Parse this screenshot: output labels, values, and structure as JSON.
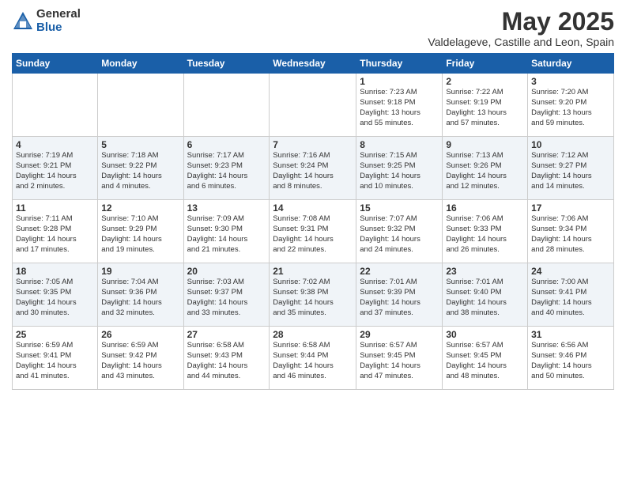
{
  "logo": {
    "general": "General",
    "blue": "Blue"
  },
  "header": {
    "month_year": "May 2025",
    "location": "Valdelageve, Castille and Leon, Spain"
  },
  "weekdays": [
    "Sunday",
    "Monday",
    "Tuesday",
    "Wednesday",
    "Thursday",
    "Friday",
    "Saturday"
  ],
  "rows": [
    [
      {
        "day": "",
        "info": ""
      },
      {
        "day": "",
        "info": ""
      },
      {
        "day": "",
        "info": ""
      },
      {
        "day": "",
        "info": ""
      },
      {
        "day": "1",
        "info": "Sunrise: 7:23 AM\nSunset: 9:18 PM\nDaylight: 13 hours\nand 55 minutes."
      },
      {
        "day": "2",
        "info": "Sunrise: 7:22 AM\nSunset: 9:19 PM\nDaylight: 13 hours\nand 57 minutes."
      },
      {
        "day": "3",
        "info": "Sunrise: 7:20 AM\nSunset: 9:20 PM\nDaylight: 13 hours\nand 59 minutes."
      }
    ],
    [
      {
        "day": "4",
        "info": "Sunrise: 7:19 AM\nSunset: 9:21 PM\nDaylight: 14 hours\nand 2 minutes."
      },
      {
        "day": "5",
        "info": "Sunrise: 7:18 AM\nSunset: 9:22 PM\nDaylight: 14 hours\nand 4 minutes."
      },
      {
        "day": "6",
        "info": "Sunrise: 7:17 AM\nSunset: 9:23 PM\nDaylight: 14 hours\nand 6 minutes."
      },
      {
        "day": "7",
        "info": "Sunrise: 7:16 AM\nSunset: 9:24 PM\nDaylight: 14 hours\nand 8 minutes."
      },
      {
        "day": "8",
        "info": "Sunrise: 7:15 AM\nSunset: 9:25 PM\nDaylight: 14 hours\nand 10 minutes."
      },
      {
        "day": "9",
        "info": "Sunrise: 7:13 AM\nSunset: 9:26 PM\nDaylight: 14 hours\nand 12 minutes."
      },
      {
        "day": "10",
        "info": "Sunrise: 7:12 AM\nSunset: 9:27 PM\nDaylight: 14 hours\nand 14 minutes."
      }
    ],
    [
      {
        "day": "11",
        "info": "Sunrise: 7:11 AM\nSunset: 9:28 PM\nDaylight: 14 hours\nand 17 minutes."
      },
      {
        "day": "12",
        "info": "Sunrise: 7:10 AM\nSunset: 9:29 PM\nDaylight: 14 hours\nand 19 minutes."
      },
      {
        "day": "13",
        "info": "Sunrise: 7:09 AM\nSunset: 9:30 PM\nDaylight: 14 hours\nand 21 minutes."
      },
      {
        "day": "14",
        "info": "Sunrise: 7:08 AM\nSunset: 9:31 PM\nDaylight: 14 hours\nand 22 minutes."
      },
      {
        "day": "15",
        "info": "Sunrise: 7:07 AM\nSunset: 9:32 PM\nDaylight: 14 hours\nand 24 minutes."
      },
      {
        "day": "16",
        "info": "Sunrise: 7:06 AM\nSunset: 9:33 PM\nDaylight: 14 hours\nand 26 minutes."
      },
      {
        "day": "17",
        "info": "Sunrise: 7:06 AM\nSunset: 9:34 PM\nDaylight: 14 hours\nand 28 minutes."
      }
    ],
    [
      {
        "day": "18",
        "info": "Sunrise: 7:05 AM\nSunset: 9:35 PM\nDaylight: 14 hours\nand 30 minutes."
      },
      {
        "day": "19",
        "info": "Sunrise: 7:04 AM\nSunset: 9:36 PM\nDaylight: 14 hours\nand 32 minutes."
      },
      {
        "day": "20",
        "info": "Sunrise: 7:03 AM\nSunset: 9:37 PM\nDaylight: 14 hours\nand 33 minutes."
      },
      {
        "day": "21",
        "info": "Sunrise: 7:02 AM\nSunset: 9:38 PM\nDaylight: 14 hours\nand 35 minutes."
      },
      {
        "day": "22",
        "info": "Sunrise: 7:01 AM\nSunset: 9:39 PM\nDaylight: 14 hours\nand 37 minutes."
      },
      {
        "day": "23",
        "info": "Sunrise: 7:01 AM\nSunset: 9:40 PM\nDaylight: 14 hours\nand 38 minutes."
      },
      {
        "day": "24",
        "info": "Sunrise: 7:00 AM\nSunset: 9:41 PM\nDaylight: 14 hours\nand 40 minutes."
      }
    ],
    [
      {
        "day": "25",
        "info": "Sunrise: 6:59 AM\nSunset: 9:41 PM\nDaylight: 14 hours\nand 41 minutes."
      },
      {
        "day": "26",
        "info": "Sunrise: 6:59 AM\nSunset: 9:42 PM\nDaylight: 14 hours\nand 43 minutes."
      },
      {
        "day": "27",
        "info": "Sunrise: 6:58 AM\nSunset: 9:43 PM\nDaylight: 14 hours\nand 44 minutes."
      },
      {
        "day": "28",
        "info": "Sunrise: 6:58 AM\nSunset: 9:44 PM\nDaylight: 14 hours\nand 46 minutes."
      },
      {
        "day": "29",
        "info": "Sunrise: 6:57 AM\nSunset: 9:45 PM\nDaylight: 14 hours\nand 47 minutes."
      },
      {
        "day": "30",
        "info": "Sunrise: 6:57 AM\nSunset: 9:45 PM\nDaylight: 14 hours\nand 48 minutes."
      },
      {
        "day": "31",
        "info": "Sunrise: 6:56 AM\nSunset: 9:46 PM\nDaylight: 14 hours\nand 50 minutes."
      }
    ]
  ]
}
